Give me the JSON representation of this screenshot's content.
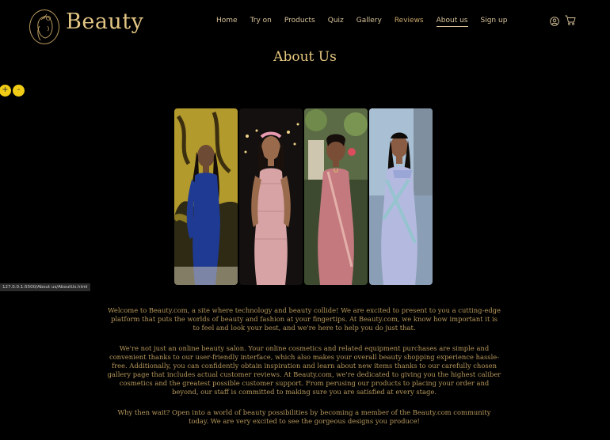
{
  "brand": {
    "name": "Beauty"
  },
  "nav": {
    "items": [
      "Home",
      "Try on",
      "Products",
      "Quiz",
      "Gallery",
      "Reviews",
      "About us",
      "Sign up"
    ],
    "active": "About us"
  },
  "icons": {
    "user": "user-icon",
    "cart": "cart-icon",
    "logo": "woman-portrait-logo-icon"
  },
  "page": {
    "title": "About Us"
  },
  "zoom": {
    "in_label": "+",
    "out_label": "-"
  },
  "status_bar": {
    "url": "127.0.0.1:5500/About us/AboutUs.html"
  },
  "about": {
    "paragraphs": [
      "Welcome to Beauty.com, a site where technology and beauty collide! We are excited to present to you a cutting-edge platform that puts the worlds of beauty and fashion at your fingertips. At Beauty.com, we know how important it is to feel and look your best, and we're here to help you do just that.",
      "We're not just an online beauty salon. Your online cosmetics and related equipment purchases are simple and convenient thanks to our user-friendly interface, which also makes your overall beauty shopping experience hassle-free. Additionally, you can confidently obtain inspiration and learn about new items thanks to our carefully chosen gallery page that includes actual customer reviews. At Beauty.com, we're dedicated to giving you the highest caliber cosmetics and the greatest possible customer support. From perusing our products to placing your order and beyond, our staff is committed to making sure you are satisfied at every stage.",
      "Why then wait? Open into a world of beauty possibilities by becoming a member of the Beauty.com community today. We are very excited to see the gorgeous designs you produce!"
    ]
  },
  "colors": {
    "gold": "#e3c584",
    "text": "#b6975b",
    "zoom_button": "#f1cc16",
    "background": "#000000"
  }
}
